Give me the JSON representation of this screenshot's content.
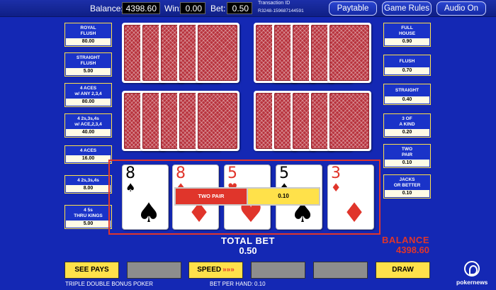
{
  "topbar": {
    "balance_label": "Balance:",
    "balance_value": "4398.60",
    "win_label": "Win:",
    "win_value": "0.00",
    "bet_label": "Bet:",
    "bet_value": "0.50",
    "transaction_label": "Transaction ID",
    "transaction_value": "R3248-159687144591",
    "paytable_button": "Paytable",
    "game_rules_button": "Game Rules",
    "audio_button": "Audio On"
  },
  "paytable_left": [
    {
      "name": "ROYAL\nFLUSH",
      "value": "80.00"
    },
    {
      "name": "STRAIGHT\nFLUSH",
      "value": "5.00"
    },
    {
      "name": "4 ACES\nw/ ANY 2,3,4",
      "value": "80.00"
    },
    {
      "name": "4 2s,3s,4s\nw/ ACE,2,3,4",
      "value": "40.00"
    },
    {
      "name": "4 ACES",
      "value": "16.00"
    },
    {
      "name": "4 2s,3s,4s",
      "value": "8.00"
    },
    {
      "name": "4 5s\nTHRU KINGS",
      "value": "5.00"
    }
  ],
  "paytable_right": [
    {
      "name": "FULL\nHOUSE",
      "value": "0.90"
    },
    {
      "name": "FLUSH",
      "value": "0.70"
    },
    {
      "name": "STRAIGHT",
      "value": "0.40"
    },
    {
      "name": "3 OF\nA KIND",
      "value": "0.20"
    },
    {
      "name": "TWO\nPAIR",
      "value": "0.10"
    },
    {
      "name": "JACKS\nOR BETTER",
      "value": "0.10"
    }
  ],
  "hand": [
    {
      "rank": "8",
      "suit": "♠",
      "color": "#000000"
    },
    {
      "rank": "8",
      "suit": "♦",
      "color": "#e0352b"
    },
    {
      "rank": "5",
      "suit": "♥",
      "color": "#e0352b"
    },
    {
      "rank": "5",
      "suit": "♠",
      "color": "#000000"
    },
    {
      "rank": "3",
      "suit": "♦",
      "color": "#e0352b"
    }
  ],
  "win_banner": {
    "hand_name": "TWO PAIR",
    "amount": "0.10"
  },
  "total_bet": {
    "label": "TOTAL BET",
    "value": "0.50"
  },
  "balance": {
    "label": "BALANCE",
    "value": "4398.60"
  },
  "buttons": {
    "see_pays": "SEE PAYS",
    "speed": "SPEED",
    "speed_arrows": "»»»",
    "draw": "DRAW"
  },
  "footer": {
    "game_name": "TRIPLE DOUBLE BONUS POKER",
    "bet_per_hand_label": "BET PER HAND:",
    "bet_per_hand_value": "0.10"
  },
  "watermark": {
    "text": "pokernews"
  },
  "colors": {
    "background": "#1428b4",
    "accent_yellow": "#ffe14a",
    "accent_red": "#e0352b"
  }
}
